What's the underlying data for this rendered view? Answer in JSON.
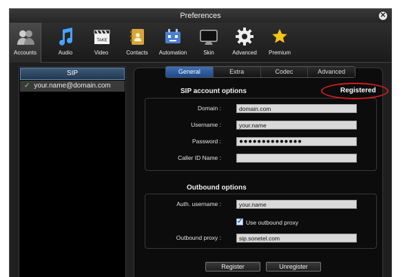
{
  "window": {
    "title": "Preferences"
  },
  "toolbar": {
    "items": [
      {
        "label": "Accounts",
        "icon": "accounts-icon"
      },
      {
        "label": "Audio",
        "icon": "audio-icon"
      },
      {
        "label": "Video",
        "icon": "video-icon"
      },
      {
        "label": "Contacts",
        "icon": "contacts-icon"
      },
      {
        "label": "Automation",
        "icon": "automation-icon"
      },
      {
        "label": "Skin",
        "icon": "skin-icon"
      },
      {
        "label": "Advanced",
        "icon": "gear-icon"
      },
      {
        "label": "Premium",
        "icon": "star-icon"
      }
    ]
  },
  "accounts_panel": {
    "header": "SIP",
    "items": [
      {
        "label": "your.name@domain.com"
      }
    ]
  },
  "tabs": [
    "General",
    "Extra",
    "Codec",
    "Advanced"
  ],
  "status": {
    "text": "Registered",
    "color": "#d21e1e"
  },
  "sip_section": {
    "title": "SIP account options",
    "domain_label": "Domain :",
    "domain_value": "domain.com",
    "username_label": "Username :",
    "username_value": "your.name",
    "password_label": "Password :",
    "password_value": "●●●●●●●●●●●●●●",
    "caller_id_label": "Caller ID Name :",
    "caller_id_value": ""
  },
  "outbound_section": {
    "title": "Outbound options",
    "auth_label": "Auth. username :",
    "auth_value": "your.name",
    "use_proxy_label": "Use outbound proxy",
    "use_proxy_checked": true,
    "proxy_label": "Outbound proxy :",
    "proxy_value": "sip.sonetel.com"
  },
  "buttons": {
    "register": "Register",
    "unregister": "Unregister"
  },
  "colors": {
    "tab_active": "#2f5fa0",
    "panel_header": "#3e5a78",
    "check_green": "#4fc24f"
  }
}
